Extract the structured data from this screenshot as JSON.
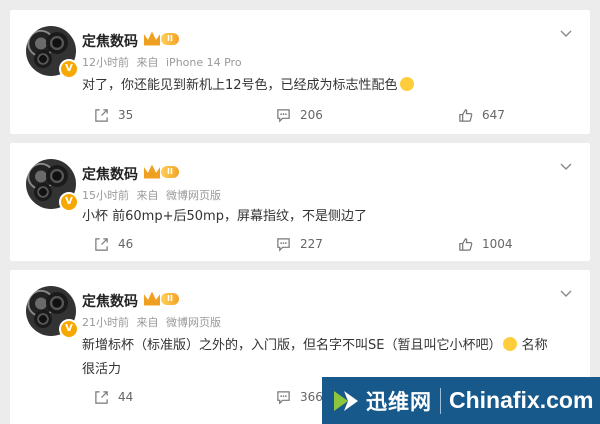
{
  "posts": [
    {
      "author": "定焦数码",
      "level": "II",
      "time": "12小时前",
      "source_prefix": "来自",
      "source": "iPhone 14 Pro",
      "text": "对了，你还能见到新机上12号色，已经成为标志性配色",
      "reposts": "35",
      "comments": "206",
      "likes": "647"
    },
    {
      "author": "定焦数码",
      "level": "II",
      "time": "15小时前",
      "source_prefix": "来自",
      "source": "微博网页版",
      "text": "小杯 前60mp+后50mp，屏幕指纹，不是侧边了",
      "reposts": "46",
      "comments": "227",
      "likes": "1004"
    },
    {
      "author": "定焦数码",
      "level": "II",
      "time": "21小时前",
      "source_prefix": "来自",
      "source": "微博网页版",
      "text_line1": "新增标杯（标准版）之外的，入门版，但名字不叫SE（暂且叫它小杯吧）",
      "text_line1_tail": "名称",
      "text_line2": "很活力",
      "reposts": "44",
      "comments": "366"
    }
  ],
  "verified_badge": "V",
  "watermark": {
    "cn": "迅维网",
    "en": "Chinafix.com"
  },
  "colors": {
    "background": "#ececec",
    "card": "#ffffff",
    "meta": "#999999",
    "badge": "#f7a800",
    "watermark_bg": "#17598a"
  }
}
